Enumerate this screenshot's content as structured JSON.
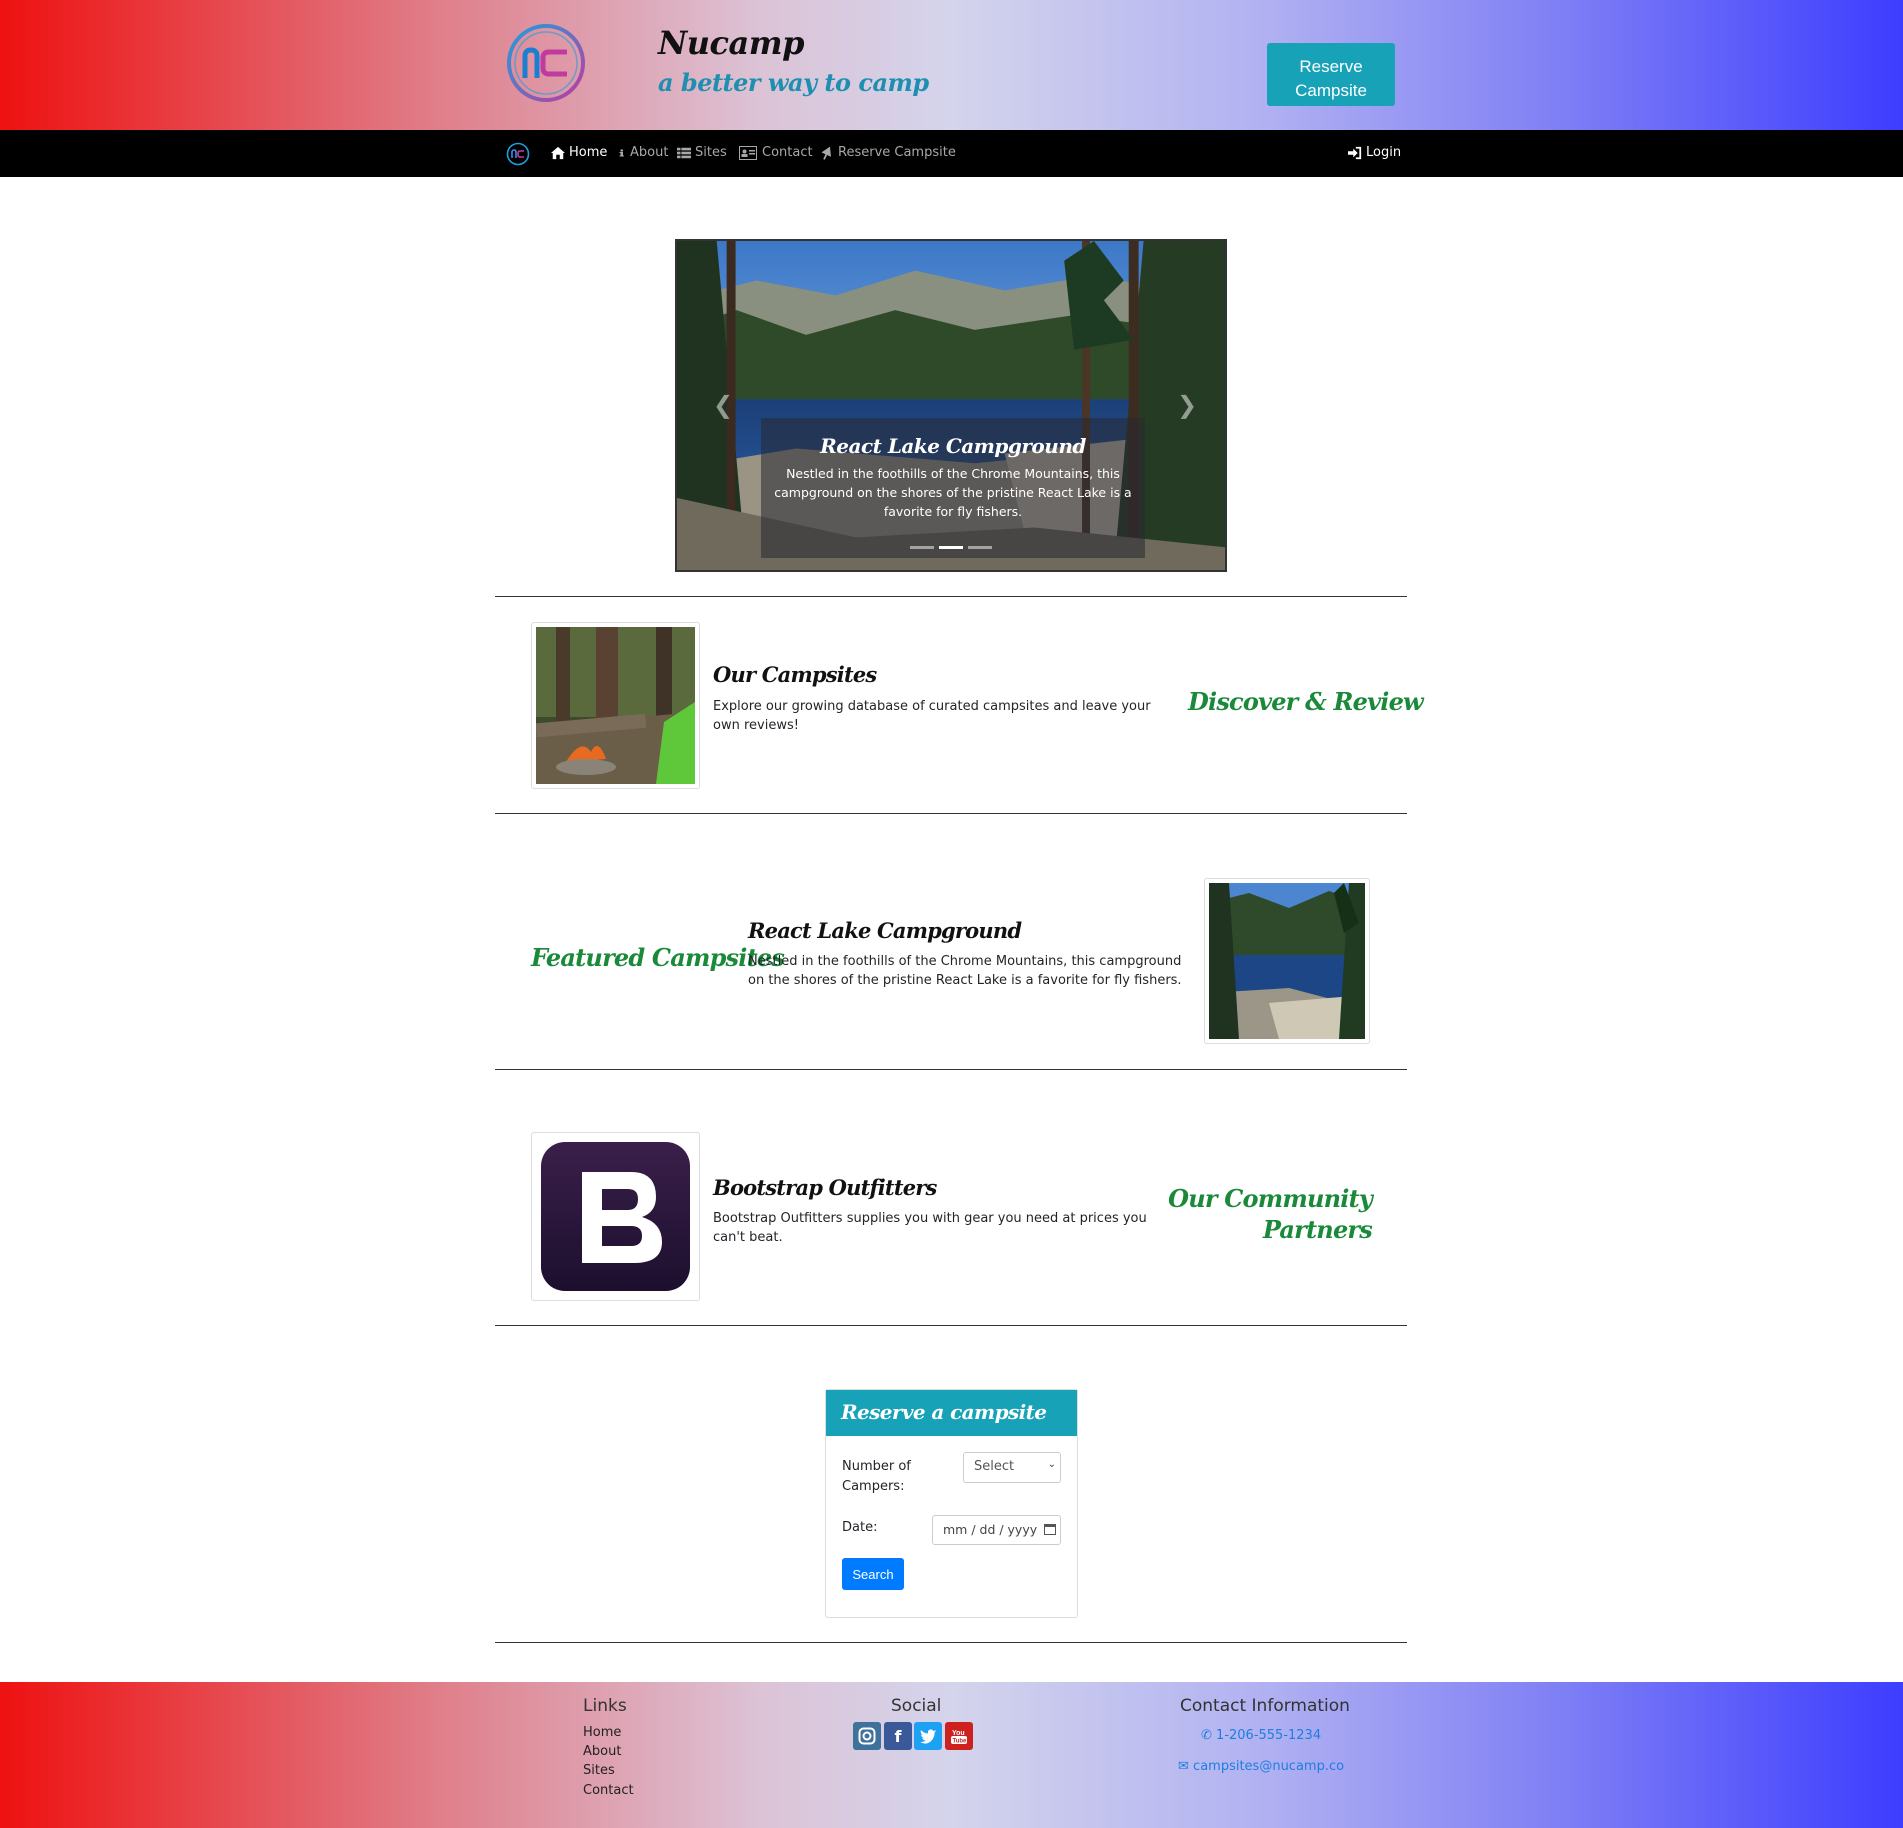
{
  "header": {
    "brand": "Nucamp",
    "tagline": "a better way to camp",
    "reserve_button": "Reserve Campsite"
  },
  "nav": {
    "items": [
      {
        "label": "Home",
        "icon": "home-icon",
        "active": true
      },
      {
        "label": "About",
        "icon": "info-icon",
        "active": false
      },
      {
        "label": "Sites",
        "icon": "list-icon",
        "active": false
      },
      {
        "label": "Contact",
        "icon": "address-card-icon",
        "active": false
      },
      {
        "label": "Reserve Campsite",
        "icon": "tree-icon",
        "active": false
      }
    ],
    "login": "Login"
  },
  "carousel": {
    "title": "React Lake Campground",
    "text": "Nestled in the foothills of the Chrome Mountains, this campground on the shores of the pristine React Lake is a favorite for fly fishers.",
    "slides": 3,
    "active_slide": 2
  },
  "sections": [
    {
      "title": "Our Campsites",
      "text": "Explore our growing database of curated campsites and leave your own reviews!",
      "side_heading": "Discover & Review"
    },
    {
      "title": "React Lake Campground",
      "text": "Nestled in the foothills of the Chrome Mountains, this campground on the shores of the pristine React Lake is a favorite for fly fishers.",
      "side_heading": "Featured Campsites"
    },
    {
      "title": "Bootstrap Outfitters",
      "text": "Bootstrap Outfitters supplies you with gear you need at prices you can't beat.",
      "side_heading_line1": "Our Community",
      "side_heading_line2": "Partners"
    }
  ],
  "reserve_form": {
    "title": "Reserve a campsite",
    "campers_label_line1": "Number of",
    "campers_label_line2": "Campers:",
    "campers_value": "Select",
    "date_label": "Date:",
    "date_placeholder": "mm / dd / yyyy",
    "search_button": "Search"
  },
  "footer": {
    "links_heading": "Links",
    "links": [
      "Home",
      "About",
      "Sites",
      "Contact"
    ],
    "social_heading": "Social",
    "social_icons": [
      "instagram-icon",
      "facebook-icon",
      "twitter-icon",
      "youtube-icon"
    ],
    "contact_heading": "Contact Information",
    "phone": "1-206-555-1234",
    "email": "campsites@nucamp.co"
  },
  "colors": {
    "accent": "#17a2b8",
    "side_heading": "#1a8a3a",
    "primary_button": "#007bff"
  }
}
